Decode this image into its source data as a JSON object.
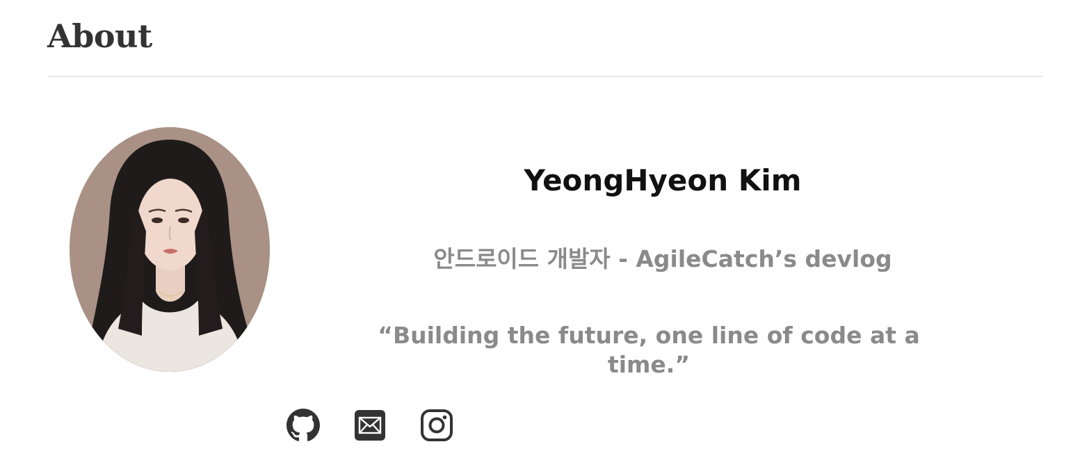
{
  "page": {
    "title": "About"
  },
  "profile": {
    "name": "YeongHyeon Kim",
    "subtitle": "안드로이드 개발자 - AgileCatch’s devlog",
    "quote": "“Building the future, one line of code at a time.”"
  },
  "social": [
    {
      "icon": "github-icon"
    },
    {
      "icon": "email-icon"
    },
    {
      "icon": "instagram-icon"
    }
  ],
  "colors": {
    "title": "#333333",
    "name": "#111111",
    "muted_text": "#8a8a8a",
    "divider": "#e9e9e9",
    "icon": "#333333",
    "avatar_background": "#a99186"
  }
}
